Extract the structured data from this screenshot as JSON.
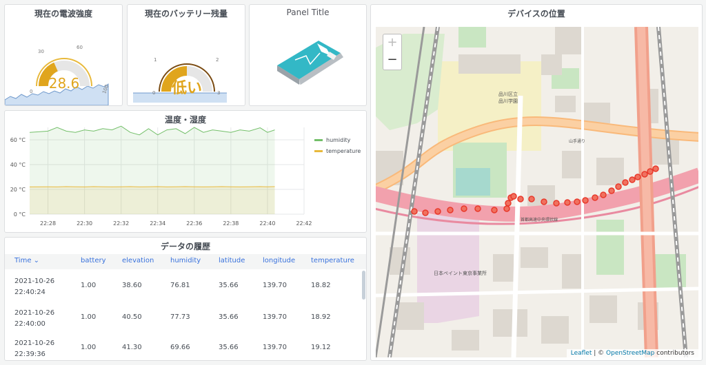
{
  "signal": {
    "title": "現在の電波強度",
    "value": "28.6",
    "ticks": [
      "0",
      "30",
      "60",
      "100"
    ]
  },
  "battery": {
    "title": "現在のバッテリー残量",
    "value": "低い",
    "ticks": [
      "0",
      "1",
      "2",
      "3"
    ]
  },
  "image_panel": {
    "title": "Panel Title"
  },
  "chart_panel": {
    "title": "温度・湿度"
  },
  "chart_data": {
    "type": "line",
    "x": [
      "22:27",
      "22:28",
      "22:28:30",
      "22:29",
      "22:29:30",
      "22:30",
      "22:30:30",
      "22:31",
      "22:31:30",
      "22:32",
      "22:32:30",
      "22:33",
      "22:33:30",
      "22:34",
      "22:34:30",
      "22:35",
      "22:35:30",
      "22:36",
      "22:36:30",
      "22:37",
      "22:37:30",
      "22:38",
      "22:38:30",
      "22:39",
      "22:39:36",
      "22:40",
      "22:40:24"
    ],
    "series": [
      {
        "name": "humidity",
        "values": [
          66,
          67,
          70,
          67,
          66,
          68,
          67,
          69,
          68,
          71,
          66,
          64,
          69,
          64,
          68,
          69,
          65,
          70,
          66,
          68,
          67,
          66,
          68,
          67,
          69.7,
          66,
          68
        ]
      },
      {
        "name": "temperature",
        "values": [
          22,
          22.1,
          22,
          22.2,
          22.1,
          22,
          22.2,
          22.1,
          22,
          22.1,
          22.2,
          22,
          22.1,
          22.2,
          22,
          22.1,
          22.2,
          22.1,
          22,
          22.1,
          22.2,
          22.1,
          22,
          22.1,
          22.2,
          22.1,
          22.2
        ]
      }
    ],
    "xticks": [
      "22:28",
      "22:30",
      "22:32",
      "22:34",
      "22:36",
      "22:38",
      "22:40",
      "22:42"
    ],
    "yticks": [
      "0 °C",
      "20 °C",
      "40 °C",
      "60 °C"
    ],
    "ylim": [
      0,
      70
    ],
    "colors": {
      "humidity": "#73bf69",
      "temperature": "#e8b93c"
    },
    "legend": "right",
    "grid": true
  },
  "table_panel": {
    "title": "データの履歴",
    "columns": [
      "Time",
      "battery",
      "elevation",
      "humidity",
      "latitude",
      "longitude",
      "temperature"
    ],
    "rows": [
      [
        "2021-10-26",
        "22:40:24",
        "1.00",
        "38.60",
        "76.81",
        "35.66",
        "139.70",
        "18.82"
      ],
      [
        "2021-10-26",
        "22:40:00",
        "1.00",
        "40.50",
        "77.73",
        "35.66",
        "139.70",
        "18.92"
      ],
      [
        "2021-10-26",
        "22:39:36",
        "1.00",
        "41.30",
        "69.66",
        "35.66",
        "139.70",
        "19.12"
      ]
    ]
  },
  "map_panel": {
    "title": "デバイスの位置",
    "zoom_in": "+",
    "zoom_out": "−",
    "attribution_leaflet": "Leaflet",
    "attribution_mid": " | © ",
    "attribution_osm": "OpenStreetMap",
    "attribution_end": " contributors",
    "labels": [
      "品川区立",
      "品川学園",
      "日本ペイント東京事業所",
      "山手通り",
      "首都高速中央環状線"
    ]
  },
  "colors": {
    "accent": "#e0a51d",
    "link": "#3871dc",
    "marker": "#e8392b"
  }
}
